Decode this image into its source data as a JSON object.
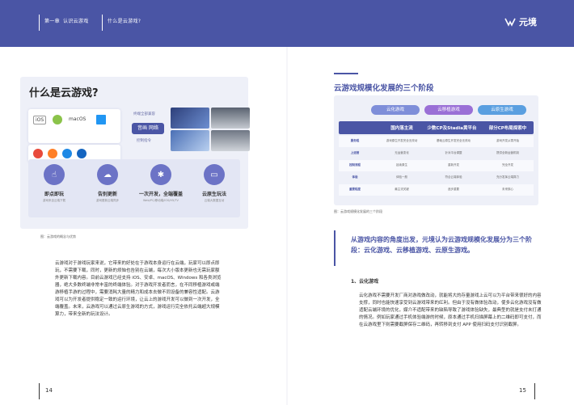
{
  "header": {
    "chapter": "第一章",
    "chapter_name": "认识云游戏",
    "section": "什么是云游戏?",
    "brand": "元境"
  },
  "left_page": {
    "figure": {
      "title": "什么是云游戏?",
      "platforms": [
        "iOS",
        "macOS"
      ],
      "label_top": "终端全部兼容",
      "label_bottom": "控制指令",
      "center_button": "音画 网络",
      "features": [
        {
          "title": "即点即玩",
          "sub": "游戏来自云端下载",
          "icon": "click-icon"
        },
        {
          "title": "告别更新",
          "sub": "游戏更新云端同步",
          "icon": "cloud-icon"
        },
        {
          "title": "一次开发，全端覆盖",
          "sub": "Web/PC/移动端/iOS/H5/TV",
          "icon": "network-icon"
        },
        {
          "title": "云原生玩法",
          "sub": "云端大数据互动",
          "icon": "screen-icon"
        }
      ],
      "caption": "图：云游戏的概念与优势"
    },
    "body": "云游戏对于游戏玩家来说，它带来的好处在于游戏本身运行在云端，玩家可以即点即玩，不需要下载，同时，更新的烦恼也告别在云端，每次大小版本更新也无需玩家额外更新下载内容。目前云游戏已经支持 iOS、安卓、macOS、Windows 和各类浏览器，绝大多数终端非常丰富的终端体验。对于游戏开发者而言，在不同移植游戏或端游移植手游的过程中，需要消耗大量的精力和成本去做不同设备的兼容性适配。云游戏可以为开发者提供稳定一致的运行环境，让云上的游戏开发可以做到一次开发，全端覆盖。未来，云游戏可以通过云原生游戏的方式，游戏运行完全依托云端超大规模算力，带来全新的玩法设计。",
    "page_number": "14"
  },
  "right_page": {
    "title": "云游戏规模化发展的三个阶段",
    "stages": [
      "云化游戏",
      "云移植游戏",
      "云原生游戏"
    ],
    "table": {
      "headers": [
        "",
        "国内落主流",
        "少数CP及Stadia黄平台",
        "部分CP布局探索中"
      ],
      "rows": [
        [
          "服务程",
          "游戏原生开发完全无改动",
          "基础云原生开发完全无改动",
          "游戏开发从零开始"
        ],
        [
          "上运营",
          "无运营变化",
          "针对平台调整",
          "提供全新运营机制"
        ],
        [
          "控制流程",
          "延续原生",
          "重新开发",
          "完全开发"
        ],
        [
          "体验",
          "体验一般",
          "符合云端体验",
          "充分发挥云端算力"
        ],
        [
          "重要程度",
          "最主流关键",
          "逐步重要",
          "未来核心"
        ]
      ]
    },
    "caption": "图：云游戏规模化发展的三个阶段",
    "quote": "从游戏内容的角度出发，元境认为云游戏规模化发展分为三个阶段：云化游戏、云移植游戏、云原生游戏。",
    "section_title": "1、云化游戏",
    "body": "云化游戏不需要开发厂商对游戏做改动，就能将大的存量游戏上云可以为平台带来很好的内容支撑，同时也能快速享受到云游戏带来的红利。但由于没有做体验改动，使多云化游戏没有做适配云端环境的优化，媒介不适配带来的缺陷导致了游戏体验缺失，最典型的就是支付未打通的情况。例如玩家通过手机体验端游的时候，原本通过手机扫描屏幕上的二维码即可支付，而在云游戏里下则需要截屏保存二维码，再转移到支付 APP 使用扫码支付识别截屏。",
    "page_number": "15"
  },
  "colors": {
    "brand": "#4a55a5",
    "stage1": "#7e8ed9",
    "stage2": "#9a6fd6",
    "stage3": "#5a9fe0"
  }
}
